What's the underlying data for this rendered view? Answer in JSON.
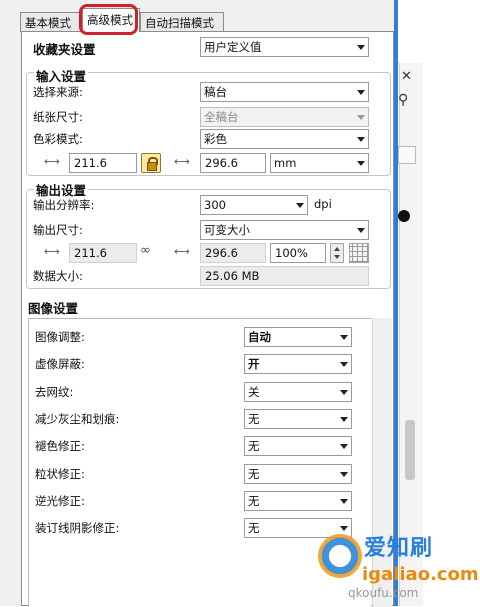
{
  "tabs": [
    "基本模式",
    "高级模式",
    "自动扫描模式"
  ],
  "favorites": {
    "label": "收藏夹设置",
    "value": "用户定义值"
  },
  "input": {
    "header": "输入设置",
    "source_label": "选择来源:",
    "source_value": "稿台",
    "paper_label": "纸张尺寸:",
    "paper_value": "全稿台",
    "color_label": "色彩模式:",
    "color_value": "彩色",
    "width": "211.6",
    "height": "296.6",
    "unit": "mm"
  },
  "output": {
    "header": "输出设置",
    "res_label": "输出分辨率:",
    "res_value": "300",
    "res_unit": "dpi",
    "size_label": "输出尺寸:",
    "size_value": "可变大小",
    "width": "211.6",
    "height": "296.6",
    "scale": "100%",
    "data_label": "数据大小:",
    "data_value": "25.06 MB"
  },
  "image": {
    "header": "图像设置",
    "rows": [
      {
        "label": "图像调整:",
        "value": "自动",
        "bold": true
      },
      {
        "label": "虚像屏蔽:",
        "value": "开",
        "bold": true
      },
      {
        "label": "去网纹:",
        "value": "关",
        "bold": false
      },
      {
        "label": "减少灰尘和划痕:",
        "value": "无",
        "bold": false
      },
      {
        "label": "褪色修正:",
        "value": "无",
        "bold": false
      },
      {
        "label": "粒状修正:",
        "value": "无",
        "bold": false
      },
      {
        "label": "逆光修正:",
        "value": "无",
        "bold": false
      },
      {
        "label": "装订线阴影修正:",
        "value": "无",
        "bold": false
      }
    ]
  },
  "watermark": {
    "name": "爱知刷",
    "url": "igaliao.com",
    "url2": "qkoufu.com"
  },
  "icons": [
    "width-icon",
    "lock-icon",
    "height-icon",
    "link-icon",
    "grid-icon",
    "close-icon",
    "search-icon"
  ]
}
